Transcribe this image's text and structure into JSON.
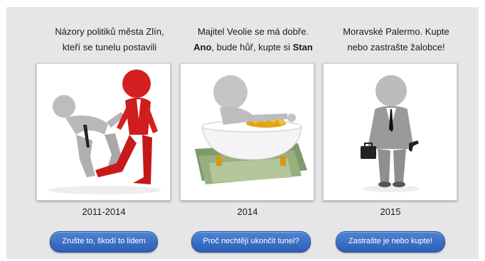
{
  "columns": [
    {
      "caption_line1": "Názory politiků města Zlín,",
      "caption_line2": "kteří se tunelu postavili",
      "year": "2011-2014",
      "button_label": "Zrušte to, škodí to lidem",
      "image_icon": "red-figure-kicking-gray-figure"
    },
    {
      "caption_line1": "Majitel Veolie se má dobře.",
      "caption_line2_bold1": "Ano",
      "caption_line2_mid": ", bude hůř, kupte si ",
      "caption_line2_bold2": "Stan",
      "year": "2014",
      "button_label": "Proč nechtějí ukončit tunel?",
      "image_icon": "figure-in-bathtub-with-money"
    },
    {
      "caption_line1": "Moravské Palermo. Kupte",
      "caption_line2": "nebo zastrašte žalobce!",
      "year": "2015",
      "button_label": "Zastrašte je nebo kupte!",
      "image_icon": "figure-with-briefcase-and-gun"
    }
  ],
  "colors": {
    "background": "#e6e6e6",
    "button": "#3a6fc4",
    "figure_red": "#d42020",
    "figure_gray": "#b5b5b5"
  }
}
